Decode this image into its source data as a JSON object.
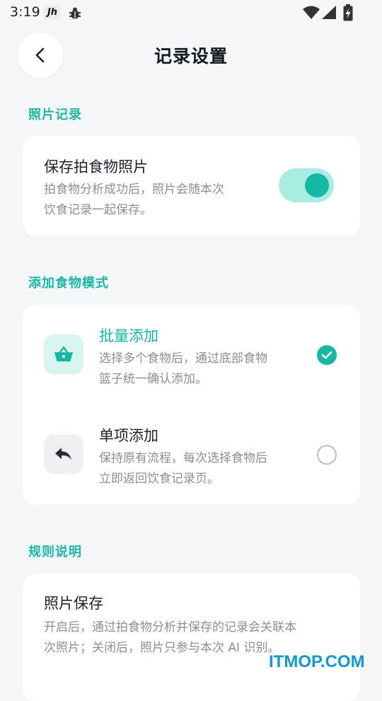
{
  "status_bar": {
    "time": "3:19",
    "app_icon": "Jh"
  },
  "header": {
    "title": "记录设置"
  },
  "photo_section": {
    "title": "照片记录",
    "item": {
      "title": "保存拍食物照片",
      "desc_line1": "拍食物分析成功后，照片会随本次",
      "desc_line2": "饮食记录一起保存。",
      "toggle_on": true
    }
  },
  "mode_section": {
    "title": "添加食物模式",
    "options": [
      {
        "title": "批量添加",
        "desc_line1": "选择多个食物后，通过底部食物",
        "desc_line2": "篮子统一确认添加。",
        "selected": true,
        "icon": "basket-icon"
      },
      {
        "title": "单项添加",
        "desc_line1": "保持原有流程，每次选择食物后",
        "desc_line2": "立即返回饮食记录页。",
        "selected": false,
        "icon": "return-arrow-icon"
      }
    ]
  },
  "rules_section": {
    "title": "规则说明",
    "item": {
      "title": "照片保存",
      "desc_line1": "开启后，通过拍食物分析并保存的记录会关联本",
      "desc_line2": "次照片；关闭后，照片只参与本次 AI 识别。"
    }
  },
  "colors": {
    "accent": "#14B9A6",
    "accent_light": "#A9EDE2",
    "background": "#F4F6F8",
    "watermark": "#1398D6"
  },
  "watermark": "ITMOP.COM"
}
